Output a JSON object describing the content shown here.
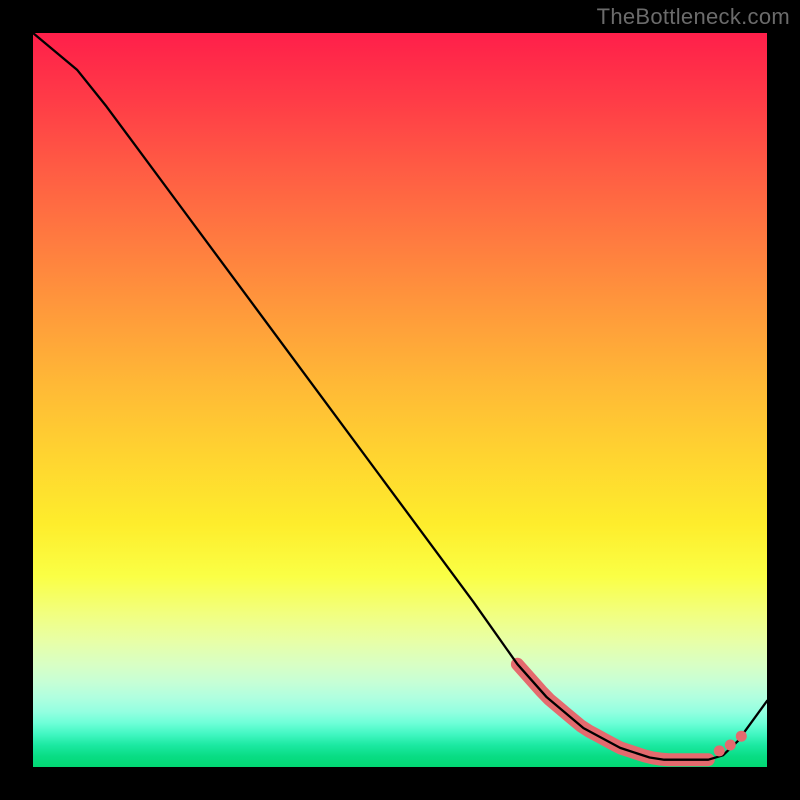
{
  "watermark": "TheBottleneck.com",
  "colors": {
    "dot": "#e46a6e",
    "line": "#000000",
    "background": "#000000"
  },
  "chart_data": {
    "type": "line",
    "title": "",
    "xlabel": "",
    "ylabel": "",
    "xlim": [
      0,
      100
    ],
    "ylim": [
      0,
      100
    ],
    "grid": false,
    "legend": false,
    "series": [
      {
        "name": "bottleneck-curve",
        "x": [
          0,
          6,
          10,
          20,
          30,
          40,
          50,
          60,
          66,
          70,
          75,
          80,
          84,
          86,
          88,
          90,
          92,
          94,
          96,
          100
        ],
        "values": [
          100,
          95,
          90,
          76.5,
          63,
          49.5,
          36,
          22.5,
          14,
          9.5,
          5.3,
          2.6,
          1.3,
          1.0,
          1.0,
          1.0,
          1.0,
          1.6,
          3.5,
          9.0
        ]
      }
    ],
    "marker_band": {
      "comment": "thick salmon highlighted segment near valley",
      "x_start": 66,
      "x_end": 92
    },
    "extra_markers": {
      "x": [
        93.5,
        95,
        96.5
      ],
      "y": [
        2.2,
        3.0,
        4.2
      ]
    }
  }
}
